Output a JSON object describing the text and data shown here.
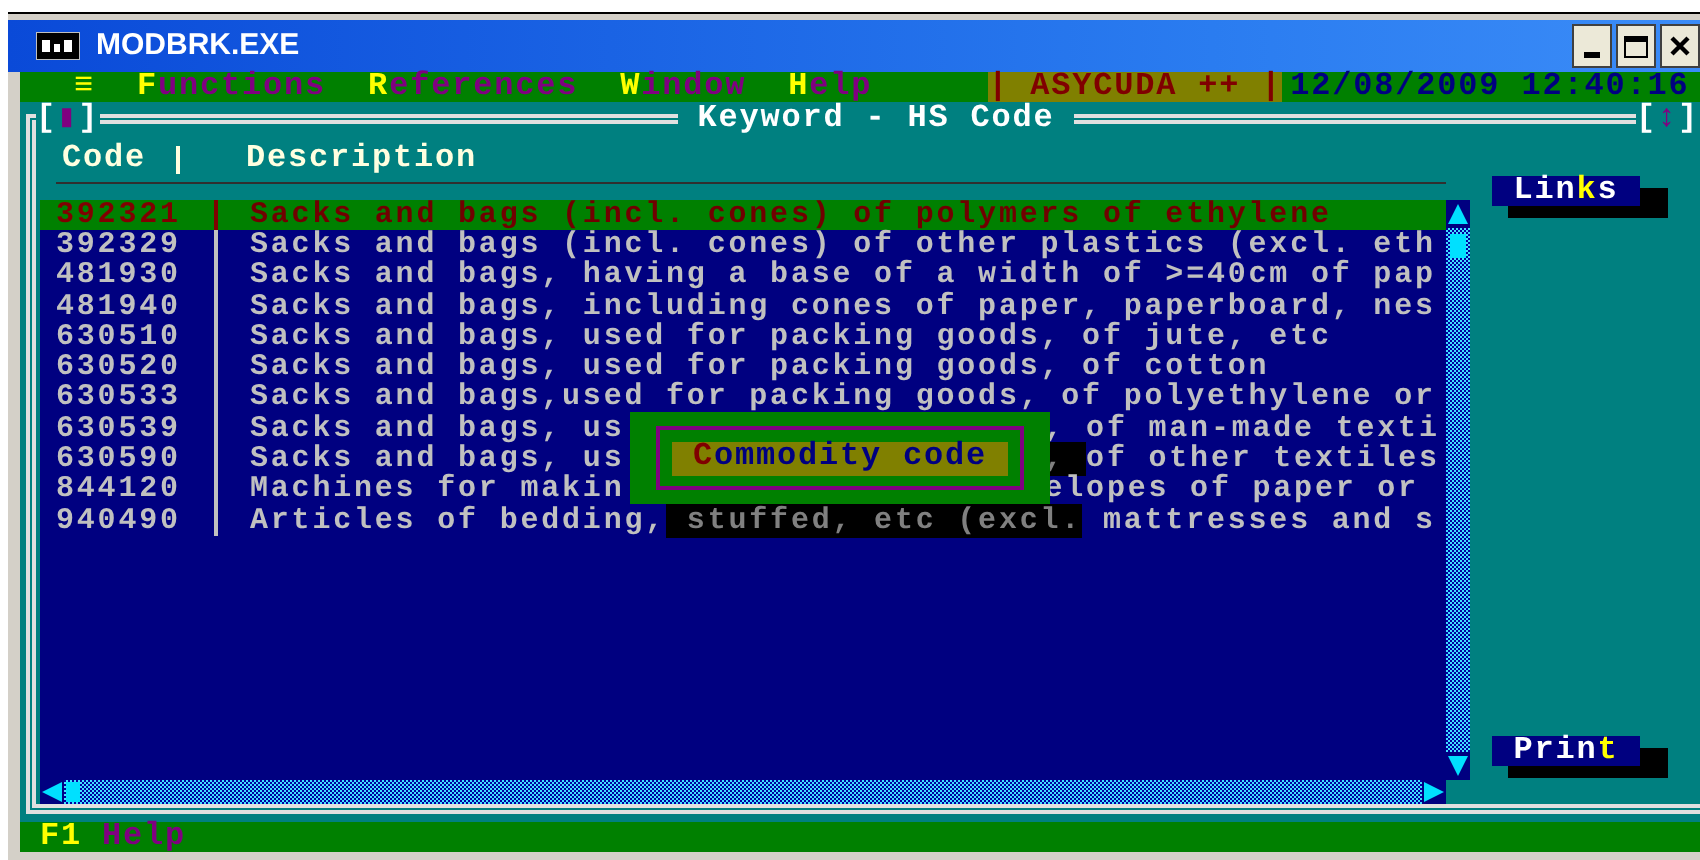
{
  "window": {
    "title": "MODBRK.EXE"
  },
  "menu": {
    "icon": "≡",
    "items": [
      {
        "hotkey": "F",
        "rest": "unctions"
      },
      {
        "hotkey": "R",
        "rest": "eferences"
      },
      {
        "hotkey": "W",
        "rest": "indow"
      },
      {
        "hotkey": "H",
        "rest": "elp"
      }
    ],
    "app": "| ASYCUDA ++ |",
    "clock": "12/08/2009 12:40:16"
  },
  "frame": {
    "title": "Keyword - HS Code",
    "left_marker": "[▮]",
    "right_marker": "[↕]"
  },
  "table": {
    "columns": [
      "Code",
      "Description"
    ],
    "rows": [
      {
        "code": "392321",
        "selected": true,
        "segments": [
          {
            "kind": "text",
            "text": "Sacks and bags (incl. cones) of polymers of ethylene"
          }
        ]
      },
      {
        "code": "392329",
        "selected": false,
        "segments": [
          {
            "kind": "text",
            "text": "Sacks and bags (incl. cones) of other plastics (excl. eth"
          }
        ]
      },
      {
        "code": "481930",
        "selected": false,
        "segments": [
          {
            "kind": "text",
            "text": "Sacks and bags, having a base of a width of >=40cm of pap"
          }
        ]
      },
      {
        "code": "481940",
        "selected": false,
        "segments": [
          {
            "kind": "text",
            "text": "Sacks and bags, including cones of paper, paperboard, nes"
          }
        ]
      },
      {
        "code": "630510",
        "selected": false,
        "segments": [
          {
            "kind": "text",
            "text": "Sacks and bags, used for packing goods, of jute, etc"
          }
        ]
      },
      {
        "code": "630520",
        "selected": false,
        "segments": [
          {
            "kind": "text",
            "text": "Sacks and bags, used for packing goods, of cotton"
          }
        ]
      },
      {
        "code": "630533",
        "selected": false,
        "segments": [
          {
            "kind": "text",
            "text": "Sacks and bags,used for packing goods, of polyethylene or"
          }
        ]
      },
      {
        "code": "630539",
        "selected": false,
        "segments": [
          {
            "kind": "text",
            "text": "Sacks and bags, us"
          },
          {
            "kind": "covered"
          },
          {
            "kind": "text",
            "text": ", of man-made texti"
          }
        ]
      },
      {
        "code": "630590",
        "selected": false,
        "segments": [
          {
            "kind": "text",
            "text": "Sacks and bags, us"
          },
          {
            "kind": "covered"
          },
          {
            "kind": "shadow",
            "text": ", "
          },
          {
            "kind": "text",
            "text": "of other textiles"
          }
        ]
      },
      {
        "code": "844120",
        "selected": false,
        "segments": [
          {
            "kind": "text",
            "text": "Machines for makin"
          },
          {
            "kind": "covered"
          },
          {
            "kind": "text",
            "text": "elopes of paper or"
          }
        ]
      },
      {
        "code": "940490",
        "selected": false,
        "segments": [
          {
            "kind": "text",
            "text": "Articles of bedding,"
          },
          {
            "kind": "shadow",
            "text": " stuffed, etc (excl."
          },
          {
            "kind": "text",
            "text": " mattresses and s"
          }
        ]
      }
    ]
  },
  "popup": {
    "hotkey": "C",
    "rest": "ommodity code"
  },
  "side_buttons": [
    {
      "before": "Lin",
      "hotkey": "k",
      "after": "s"
    },
    {
      "before": "Prin",
      "hotkey": "t"
    }
  ],
  "status_bar": {
    "key": "F1",
    "label": "Help"
  }
}
